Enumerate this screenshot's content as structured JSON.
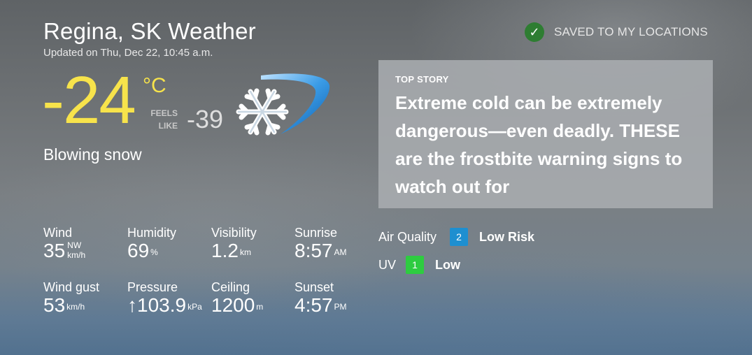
{
  "header": {
    "city": "Regina, SK Weather",
    "updated": "Updated on Thu, Dec 22, 10:45 a.m.",
    "saved_label": "SAVED TO MY LOCATIONS",
    "saved_icon": "check-icon",
    "saved_color": "#2e7d32"
  },
  "current": {
    "temperature": "-24",
    "unit": "°C",
    "feels_like_label_1": "FEELS",
    "feels_like_label_2": "LIKE",
    "feels_like": "-39",
    "condition": "Blowing snow",
    "icon": "snowflake-wind-icon",
    "temp_color": "#f7e34b"
  },
  "top_story": {
    "kicker": "TOP STORY",
    "title": "Extreme cold can be extremely dangerous—even deadly. THESE are the frostbite warning signs to watch out for"
  },
  "stats": {
    "wind": {
      "label": "Wind",
      "value": "35",
      "dir": "NW",
      "unit": "km/h"
    },
    "humidity": {
      "label": "Humidity",
      "value": "69",
      "unit": "%"
    },
    "visibility": {
      "label": "Visibility",
      "value": "1.2",
      "unit": "km"
    },
    "sunrise": {
      "label": "Sunrise",
      "value": "8:57",
      "unit": "AM"
    },
    "wind_gust": {
      "label": "Wind gust",
      "value": "53",
      "unit": "km/h"
    },
    "pressure": {
      "label": "Pressure",
      "value": "↑103.9",
      "unit": "kPa"
    },
    "ceiling": {
      "label": "Ceiling",
      "value": "1200",
      "unit": "m"
    },
    "sunset": {
      "label": "Sunset",
      "value": "4:57",
      "unit": "PM"
    }
  },
  "air_quality": {
    "label": "Air Quality",
    "index": "2",
    "risk": "Low Risk",
    "color": "#1e8fd0"
  },
  "uv": {
    "label": "UV",
    "index": "1",
    "risk": "Low",
    "color": "#2ecc40"
  }
}
